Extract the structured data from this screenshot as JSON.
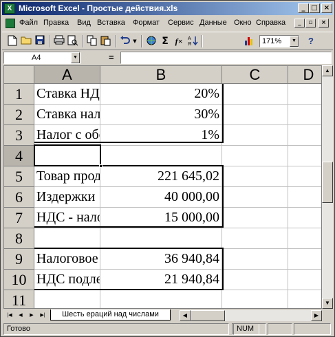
{
  "window": {
    "title": "Microsoft Excel - Простые действия.xls",
    "app_icon_label": "X",
    "minimize_icon": "_",
    "maximize_icon": "□",
    "close_icon": "×"
  },
  "menu": {
    "items": [
      "Файл",
      "Правка",
      "Вид",
      "Вставка",
      "Формат",
      "Сервис",
      "Данные",
      "Окно",
      "Справка"
    ],
    "doc_minimize_icon": "_",
    "doc_restore_icon": "▫",
    "doc_close_icon": "×"
  },
  "toolbar": {
    "zoom": "171%",
    "sigma": "Σ",
    "fx": "f×"
  },
  "formula_bar": {
    "name_box": "A4",
    "equals": "=",
    "formula": ""
  },
  "sheet": {
    "columns": [
      "A",
      "B",
      "C",
      "D"
    ],
    "rows": [
      {
        "n": "1",
        "a": "Ставка НДС",
        "b": "20%"
      },
      {
        "n": "2",
        "a": "Ставка налога",
        "b": "30%"
      },
      {
        "n": "3",
        "a": "Налог с оборота",
        "b": "1%"
      },
      {
        "n": "4",
        "a": "",
        "b": ""
      },
      {
        "n": "5",
        "a": "Товар продан",
        "b": "221 645,02"
      },
      {
        "n": "6",
        "a": "Издержки",
        "b": "40 000,00"
      },
      {
        "n": "7",
        "a": "НДС - налог",
        "b": "15 000,00"
      },
      {
        "n": "8",
        "a": "",
        "b": ""
      },
      {
        "n": "9",
        "a": "Налоговое",
        "b": "36 940,84"
      },
      {
        "n": "10",
        "a": "НДС подлежит",
        "b": "21 940,84"
      },
      {
        "n": "11",
        "a": "",
        "b": ""
      }
    ],
    "active_cell": "A4"
  },
  "tabs": {
    "sheet_tab": "Шесть ераций над числами"
  },
  "status": {
    "text": "Готово",
    "num": "NUM"
  }
}
